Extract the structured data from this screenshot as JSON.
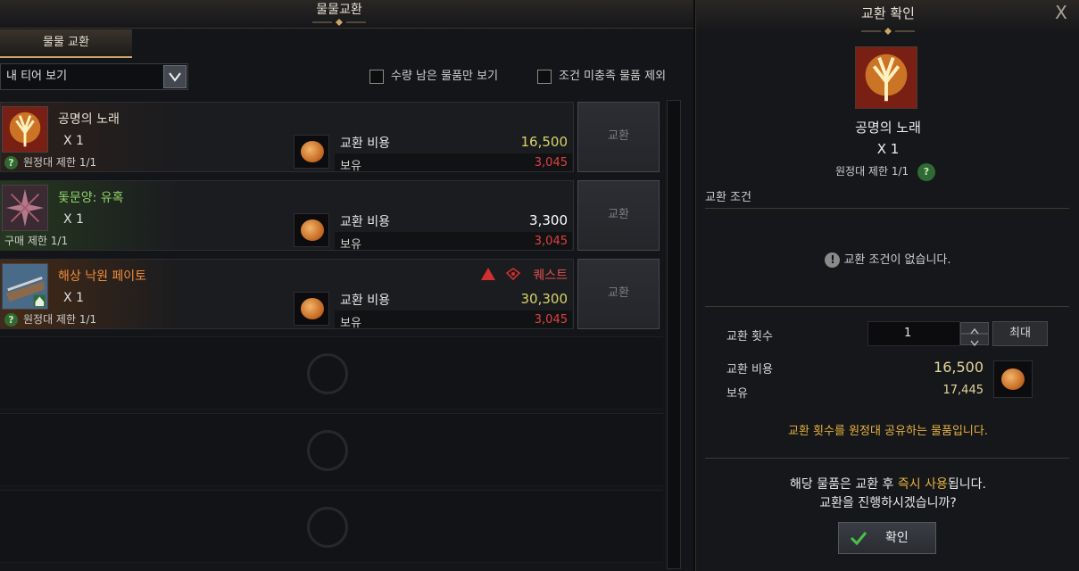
{
  "left": {
    "title": "물물교환",
    "tab_label": "물물 교환",
    "tier_select": "내 티어 보기",
    "filter_1": "수량 남은 물품만 보기",
    "filter_2": "조건 미충족 물품 제외"
  },
  "items": [
    {
      "name": "공명의 노래",
      "name_color": "#e8e0d0",
      "qty": "X 1",
      "limit": "원정대 제한 1/1",
      "has_question": true,
      "cost_label": "교환 비용",
      "cost": "16,500",
      "cost_color": "#d7d46a",
      "own_label": "보유",
      "own": "3,045",
      "button": "교환",
      "quest": ""
    },
    {
      "name": "돛문양: 유혹",
      "name_color": "#8fd16a",
      "qty": "X 1",
      "limit": "구매 제한 1/1",
      "has_question": false,
      "cost_label": "교환 비용",
      "cost": "3,300",
      "cost_color": "#ffffff",
      "own_label": "보유",
      "own": "3,045",
      "button": "교환",
      "quest": ""
    },
    {
      "name": "해상 낙원 페이토",
      "name_color": "#f08c3a",
      "qty": "X 1",
      "limit": "원정대 제한 1/1",
      "has_question": true,
      "cost_label": "교환 비용",
      "cost": "30,300",
      "cost_color": "#d7d46a",
      "own_label": "보유",
      "own": "3,045",
      "button": "교환",
      "quest": "퀘스트"
    }
  ],
  "right": {
    "title": "교환 확인",
    "close": "X",
    "item_name": "공명의 노래",
    "item_qty": "X 1",
    "item_limit": "원정대 제한 1/1",
    "conditions_label": "교환 조건",
    "no_conditions": "교환 조건이 없습니다.",
    "count_label": "교환 횟수",
    "count_value": "1",
    "max_button": "최대",
    "cost_label": "교환 비용",
    "cost_value": "16,500",
    "own_label": "보유",
    "own_value": "17,445",
    "shared_note": "교환 횟수를 원정대 공유하는 물품입니다.",
    "confirm_pre": "해당 물품은 교환 후 ",
    "confirm_hl": "즉시 사용",
    "confirm_post": "됩니다.",
    "confirm_line2": "교환을 진행하시겠습니까?",
    "confirm_button": "확인"
  },
  "colors": {
    "accent_gold": "#e6b23e",
    "warn_red": "#e04040",
    "cost_yellow": "#d7d46a"
  }
}
